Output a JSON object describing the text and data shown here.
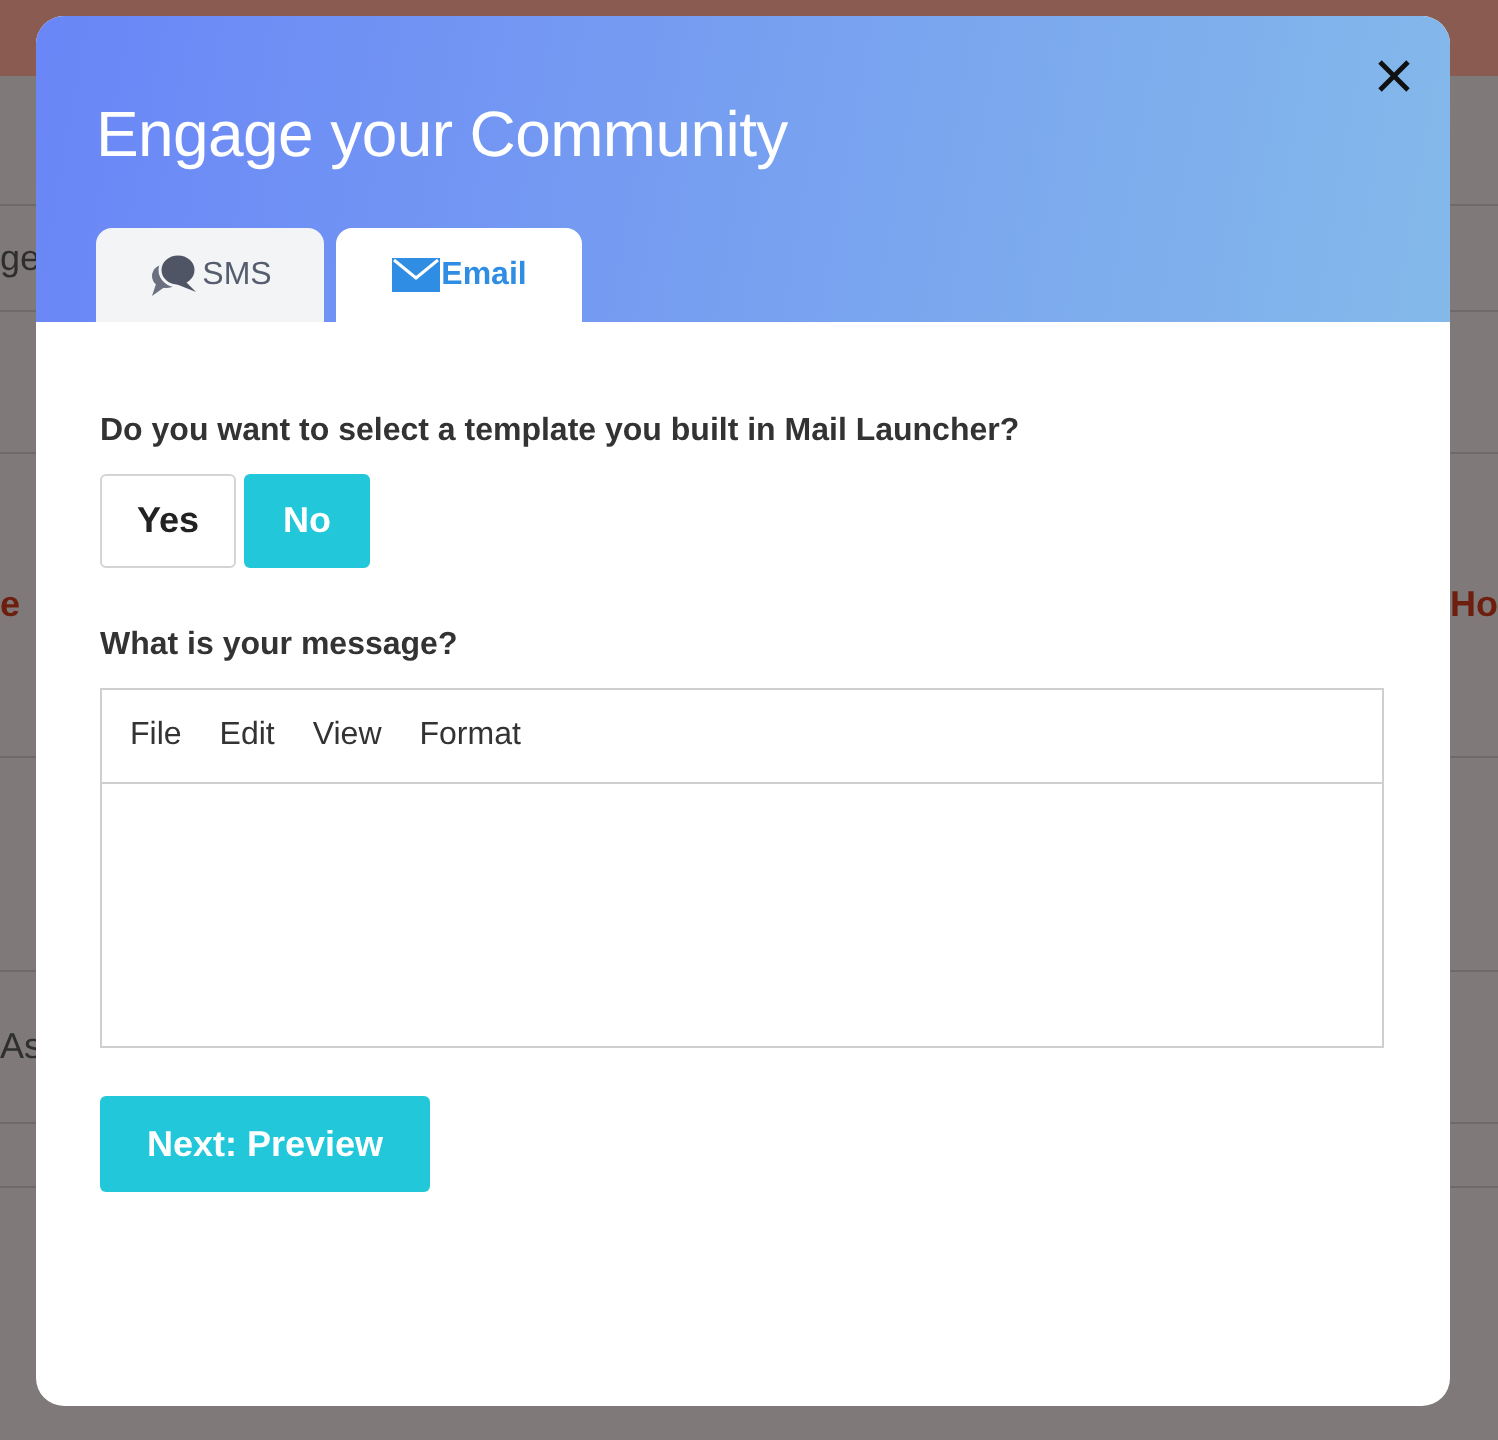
{
  "background": {
    "rows": [
      {
        "left": "ge",
        "right": "",
        "kind": "plain"
      },
      {
        "left": "e",
        "right": "Ho",
        "kind": "accent"
      },
      {
        "left": "As",
        "right": "",
        "kind": "plain"
      }
    ]
  },
  "dialog": {
    "title": "Engage your Community",
    "tabs": [
      {
        "label": "SMS",
        "kind": "sms",
        "selected": false
      },
      {
        "label": "Email",
        "kind": "email",
        "selected": true
      }
    ],
    "question": "Do you want to select a template you built in Mail Launcher?",
    "choices": [
      {
        "label": "Yes",
        "selected": false
      },
      {
        "label": "No",
        "selected": true
      }
    ],
    "message_label": "What is your message?",
    "editor_menu": [
      "File",
      "Edit",
      "View",
      "Format"
    ],
    "next_button": "Next: Preview"
  }
}
